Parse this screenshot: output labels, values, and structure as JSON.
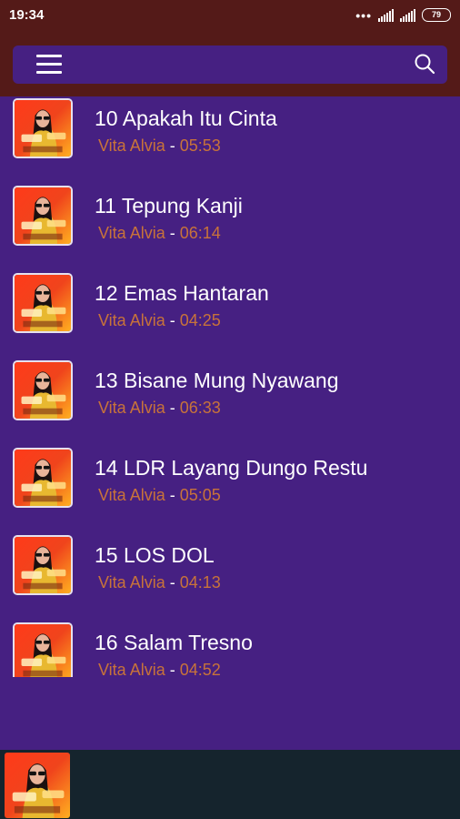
{
  "status_bar": {
    "time": "19:34",
    "dots": "•••",
    "battery": "79"
  },
  "toolbar": {
    "menu_icon": "hamburger-menu-icon",
    "search_icon": "search-icon"
  },
  "songs": [
    {
      "title": "10 Apakah Itu Cinta",
      "artist": "Vita Alvia",
      "separator": " - ",
      "duration": "05:53"
    },
    {
      "title": "11 Tepung Kanji",
      "artist": "Vita Alvia",
      "separator": " - ",
      "duration": "06:14"
    },
    {
      "title": "12 Emas Hantaran",
      "artist": "Vita Alvia",
      "separator": " - ",
      "duration": "04:25"
    },
    {
      "title": "13 Bisane Mung Nyawang",
      "artist": "Vita Alvia",
      "separator": " - ",
      "duration": "06:33"
    },
    {
      "title": "14  LDR Layang Dungo Restu",
      "artist": "Vita Alvia",
      "separator": " - ",
      "duration": "05:05"
    },
    {
      "title": "15 LOS DOL",
      "artist": "Vita Alvia",
      "separator": " - ",
      "duration": "04:13"
    },
    {
      "title": "16 Salam Tresno",
      "artist": "Vita Alvia",
      "separator": " - ",
      "duration": "04:52"
    }
  ],
  "colors": {
    "header": "#541a18",
    "background": "#462082",
    "artist": "#c8733a",
    "player": "#15242d"
  }
}
